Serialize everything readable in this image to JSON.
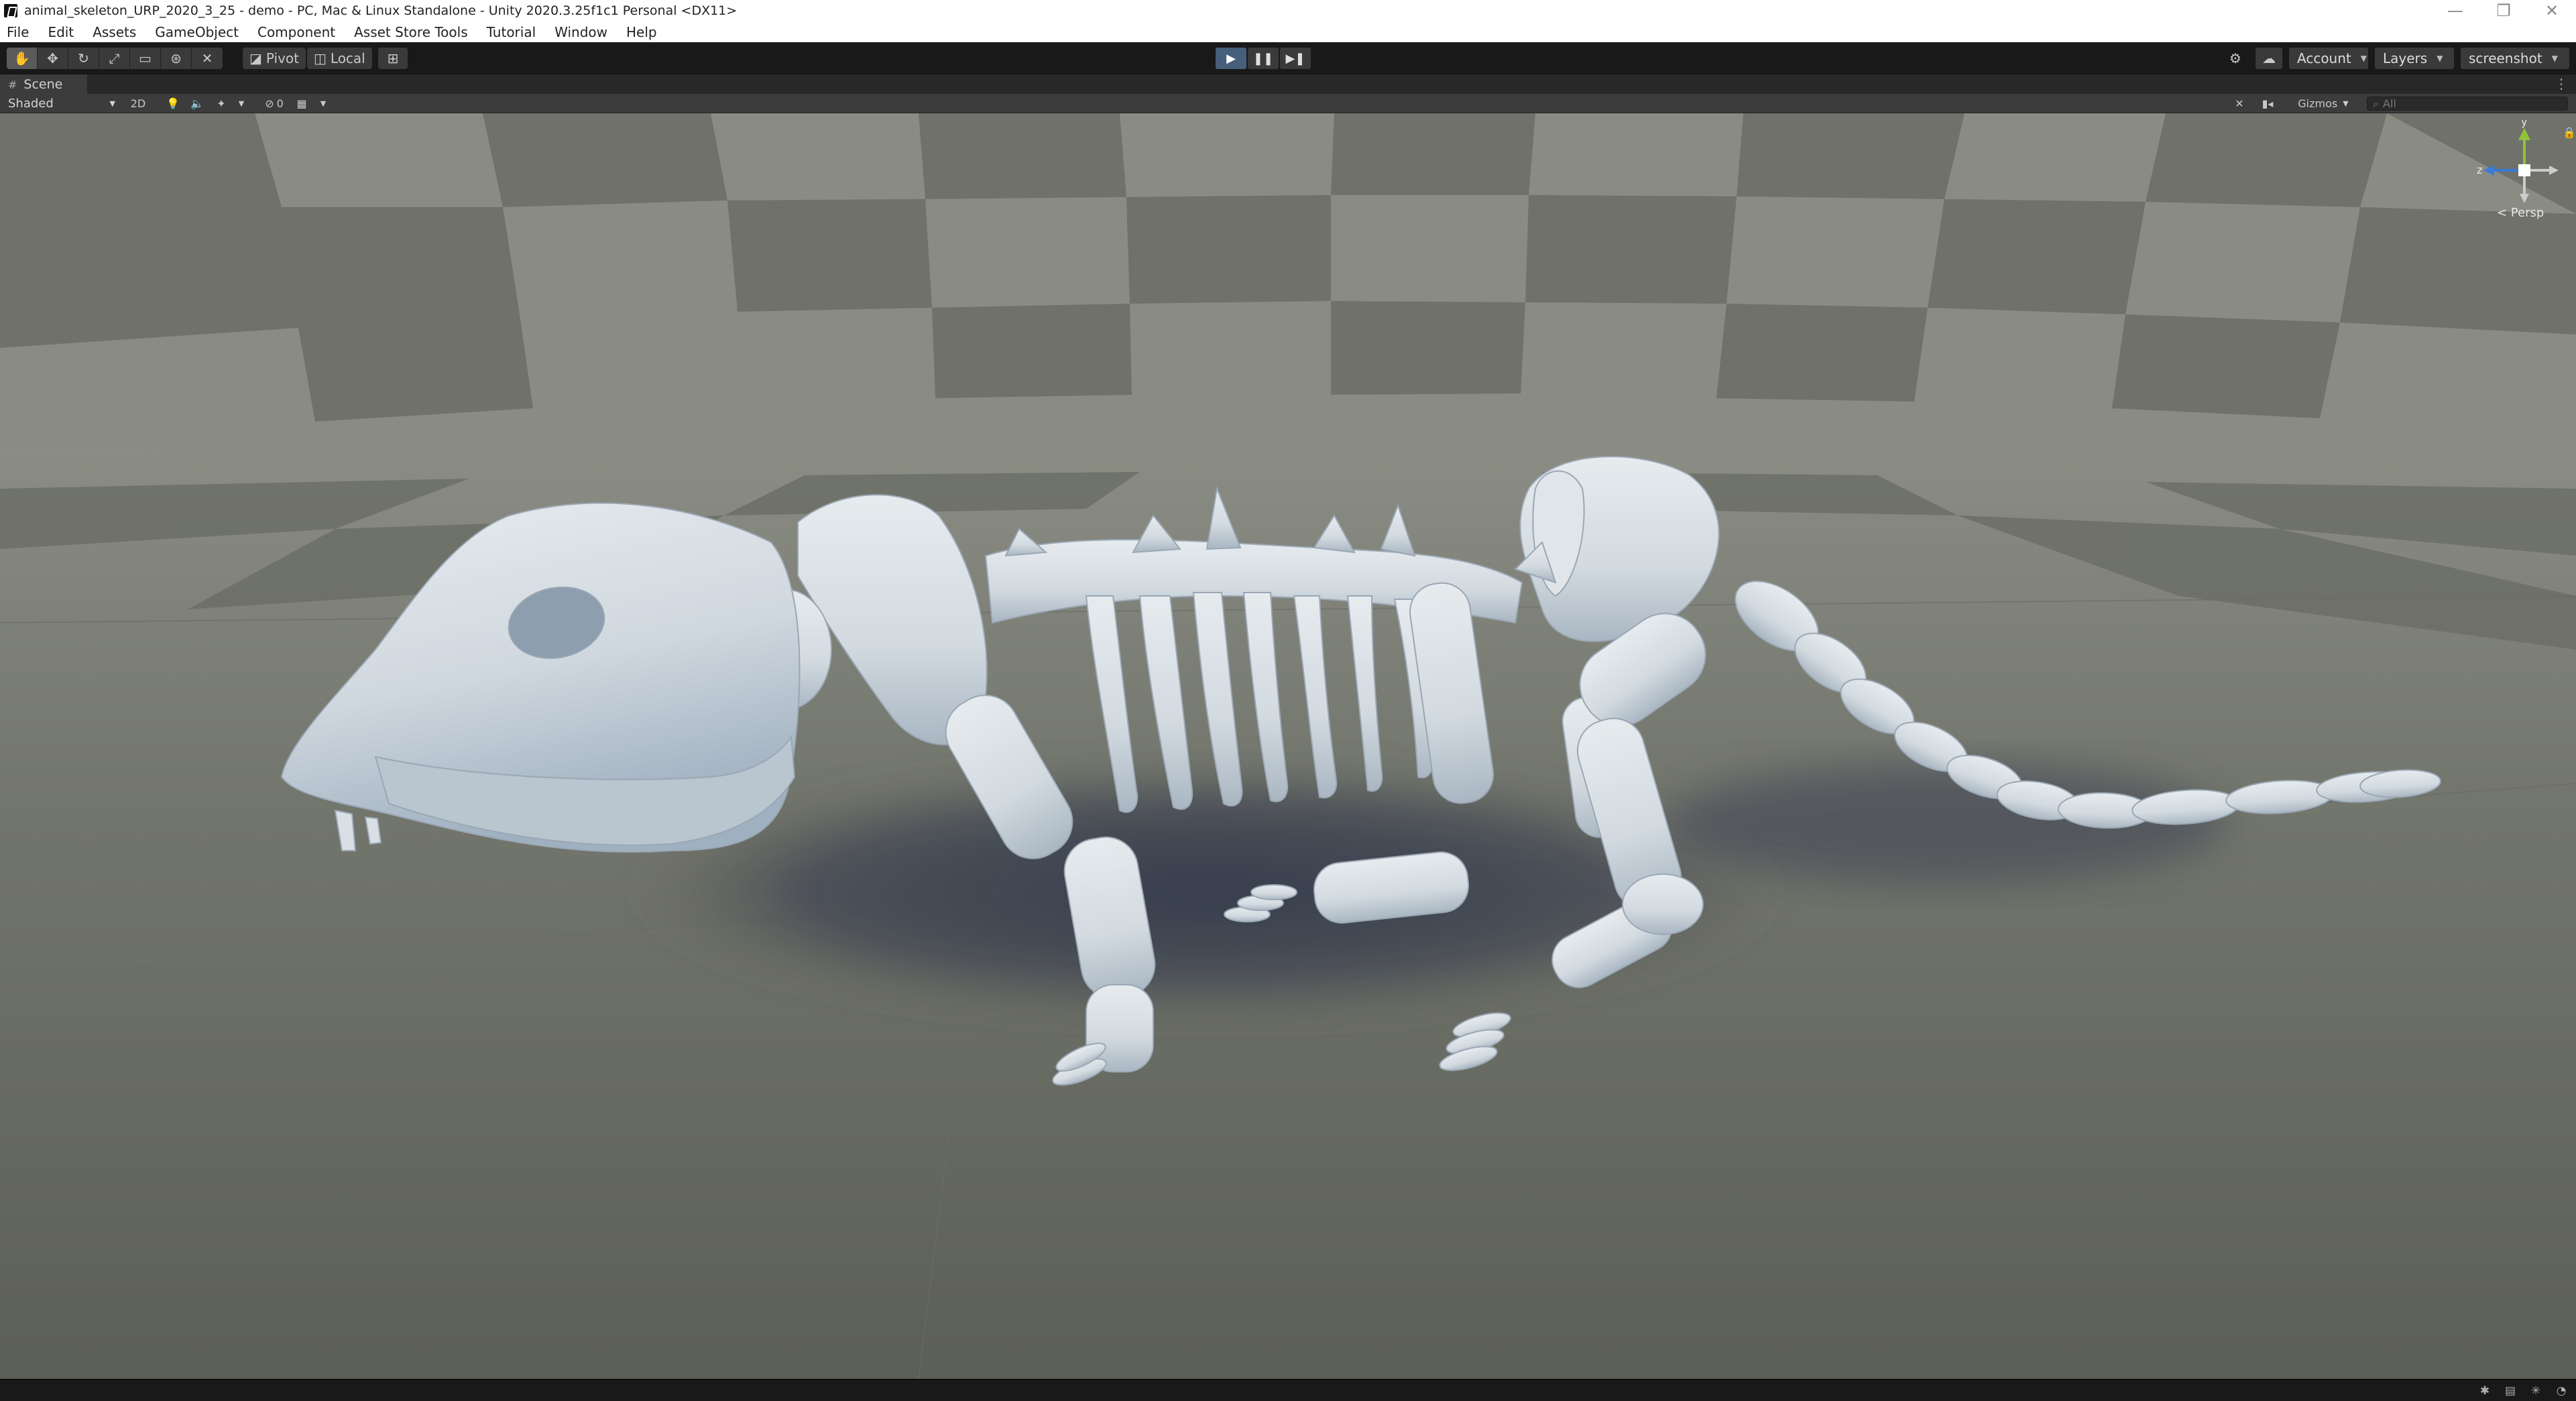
{
  "window": {
    "title": "animal_skeleton_URP_2020_3_25 - demo - PC, Mac & Linux Standalone - Unity 2020.3.25f1c1 Personal <DX11>",
    "controls": [
      "—",
      "❐",
      "✕"
    ]
  },
  "menu": {
    "items": [
      "File",
      "Edit",
      "Assets",
      "GameObject",
      "Component",
      "Asset Store Tools",
      "Tutorial",
      "Window",
      "Help"
    ]
  },
  "toolbar": {
    "tools": [
      "✋",
      "✥",
      "↻",
      "⤢",
      "▭",
      "⊛",
      "✕"
    ],
    "pivot_label": "Pivot",
    "local_label": "Local",
    "grid_snap_icon": "grid-snap-icon",
    "play_icons": [
      "▶",
      "❚❚",
      "▶❚"
    ],
    "account_label": "Account",
    "layers_label": "Layers",
    "layout_label": "screenshot"
  },
  "scene_tab": {
    "label": "Scene"
  },
  "scene_toolbar": {
    "shading_mode": "Shaded",
    "twod_label": "2D",
    "hidden_count": "0",
    "gizmos_label": "Gizmos",
    "search_placeholder": "All"
  },
  "viewport": {
    "projection_label": "< Persp",
    "axis_labels": {
      "y": "y",
      "z": "z"
    },
    "colors": {
      "sky": "#7f8078",
      "floor_light": "#8c8e84",
      "floor_dark": "#5f6159",
      "bone": "#dde3e6",
      "bone_shade": "#a9b6c2",
      "shadow": "#3c4150"
    }
  }
}
